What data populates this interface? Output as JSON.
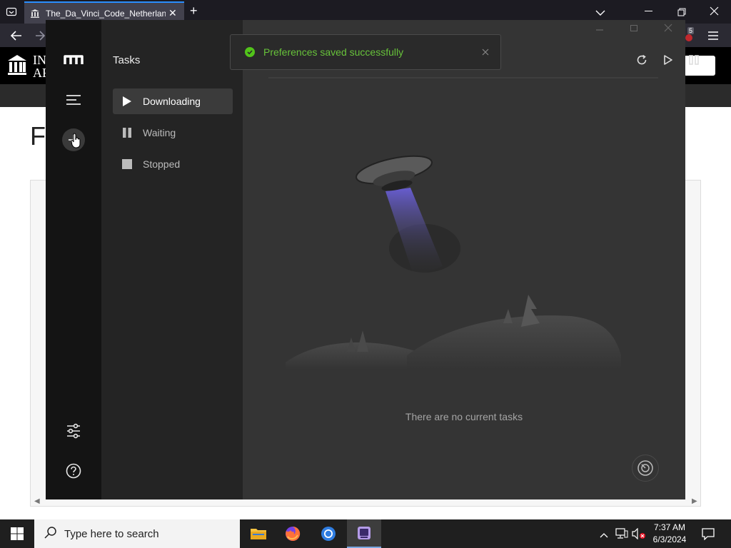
{
  "browser": {
    "tab_title": "The_Da_Vinci_Code_Netherlands",
    "badge_count": "5",
    "new_tab": "+",
    "tab_close": "✕"
  },
  "website": {
    "logo_text_1": "IN",
    "logo_text_2": "AR",
    "page_letter": "F"
  },
  "app": {
    "sidebar": {
      "title": "Tasks",
      "items": [
        {
          "label": "Downloading",
          "icon": "play-icon",
          "active": true
        },
        {
          "label": "Waiting",
          "icon": "pause-icon",
          "active": false
        },
        {
          "label": "Stopped",
          "icon": "stop-icon",
          "active": false
        }
      ]
    },
    "toast": {
      "message": "Preferences saved successfully",
      "icon": "check-circle-icon",
      "color": "#67c23a"
    },
    "empty_state": {
      "text": "There are no current tasks"
    },
    "toolbar": [
      "refresh-icon",
      "resume-all-icon",
      "pause-all-icon"
    ]
  },
  "taskbar": {
    "search_placeholder": "Type here to search",
    "time": "7:37 AM",
    "date": "6/3/2024"
  }
}
